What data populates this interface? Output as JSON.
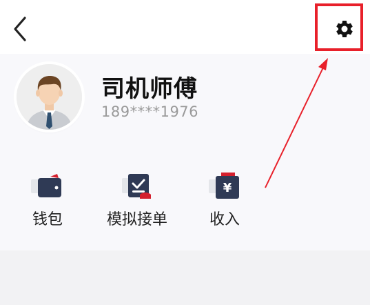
{
  "header": {
    "back_icon": "chevron-left-icon",
    "settings_icon": "gear-icon"
  },
  "profile": {
    "name": "司机师傅",
    "phone": "189****1976",
    "avatar_icon": "driver-avatar"
  },
  "actions": [
    {
      "label": "钱包",
      "icon": "wallet-icon"
    },
    {
      "label": "模拟接单",
      "icon": "simulate-order-icon"
    },
    {
      "label": "收入",
      "icon": "income-yen-icon"
    }
  ],
  "colors": {
    "highlight": "#e8202a",
    "icon_navy": "#2f3a55",
    "icon_red": "#d4202e"
  }
}
